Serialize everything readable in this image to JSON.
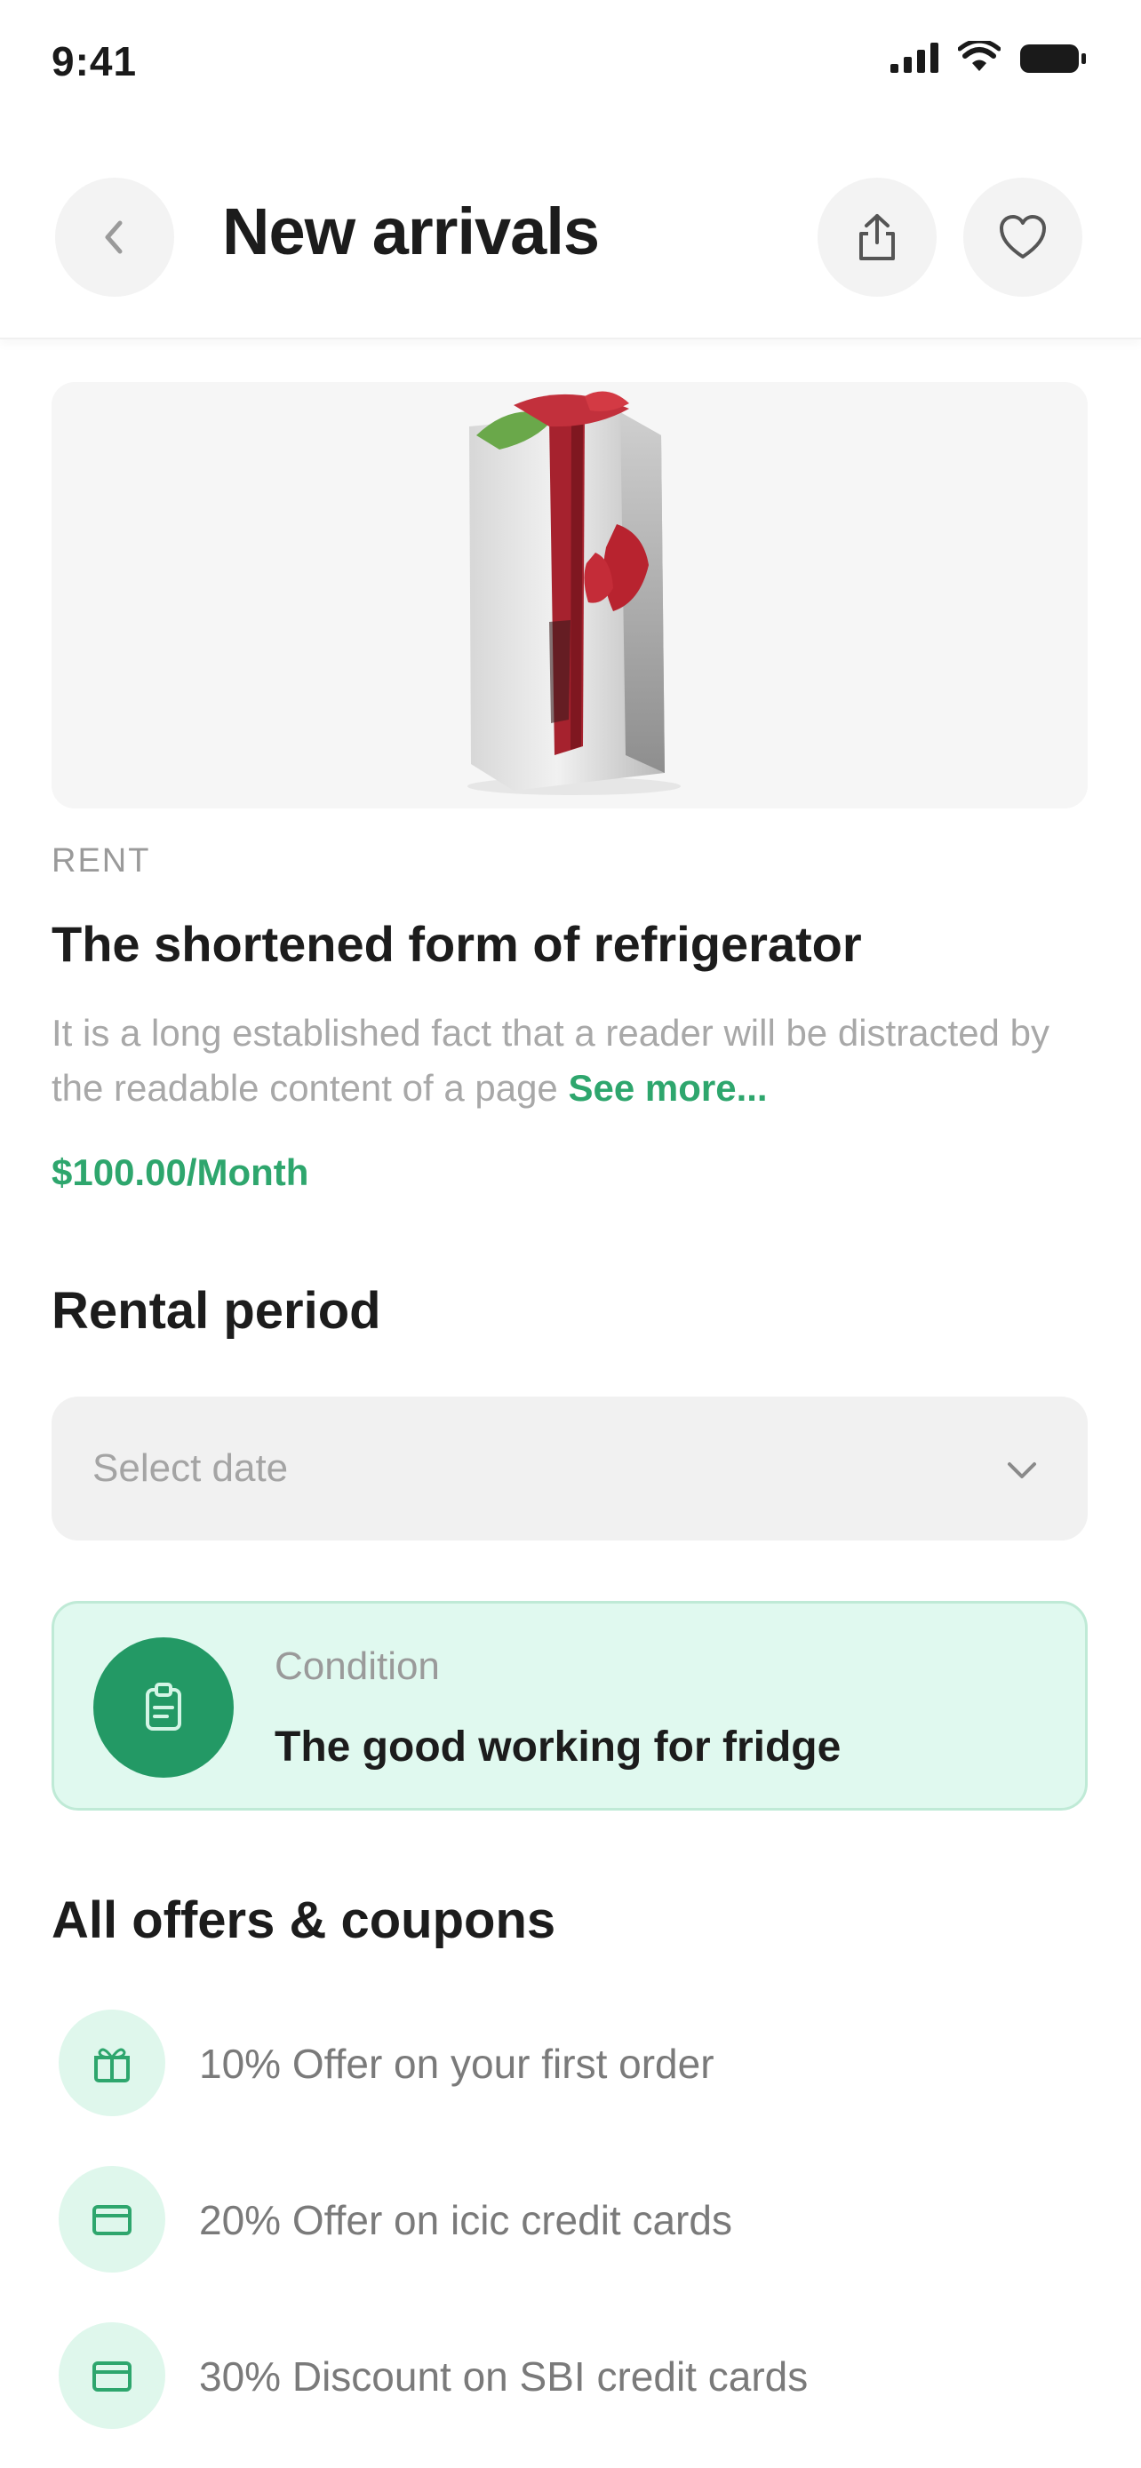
{
  "status_bar": {
    "time": "9:41"
  },
  "header": {
    "title": "New arrivals"
  },
  "product": {
    "category": "RENT",
    "title": "The shortened form of refrigerator",
    "description": "It is a long established fact that a reader will be distracted by the readable content of a page",
    "see_more": "See more...",
    "price": "$100.00/Month"
  },
  "rental": {
    "section_title": "Rental period",
    "select_placeholder": "Select date"
  },
  "condition": {
    "label": "Condition",
    "value": "The good working for fridge"
  },
  "offers": {
    "section_title": "All offers & coupons",
    "items": [
      {
        "text": "10% Offer on your first order",
        "icon": "gift-icon"
      },
      {
        "text": "20% Offer on icic credit cards",
        "icon": "card-icon"
      },
      {
        "text": "30% Discount on SBI credit cards",
        "icon": "card-icon"
      }
    ]
  },
  "colors": {
    "accent": "#2ea66d",
    "accent_dark": "#239965",
    "accent_light": "#e0f9ef"
  }
}
